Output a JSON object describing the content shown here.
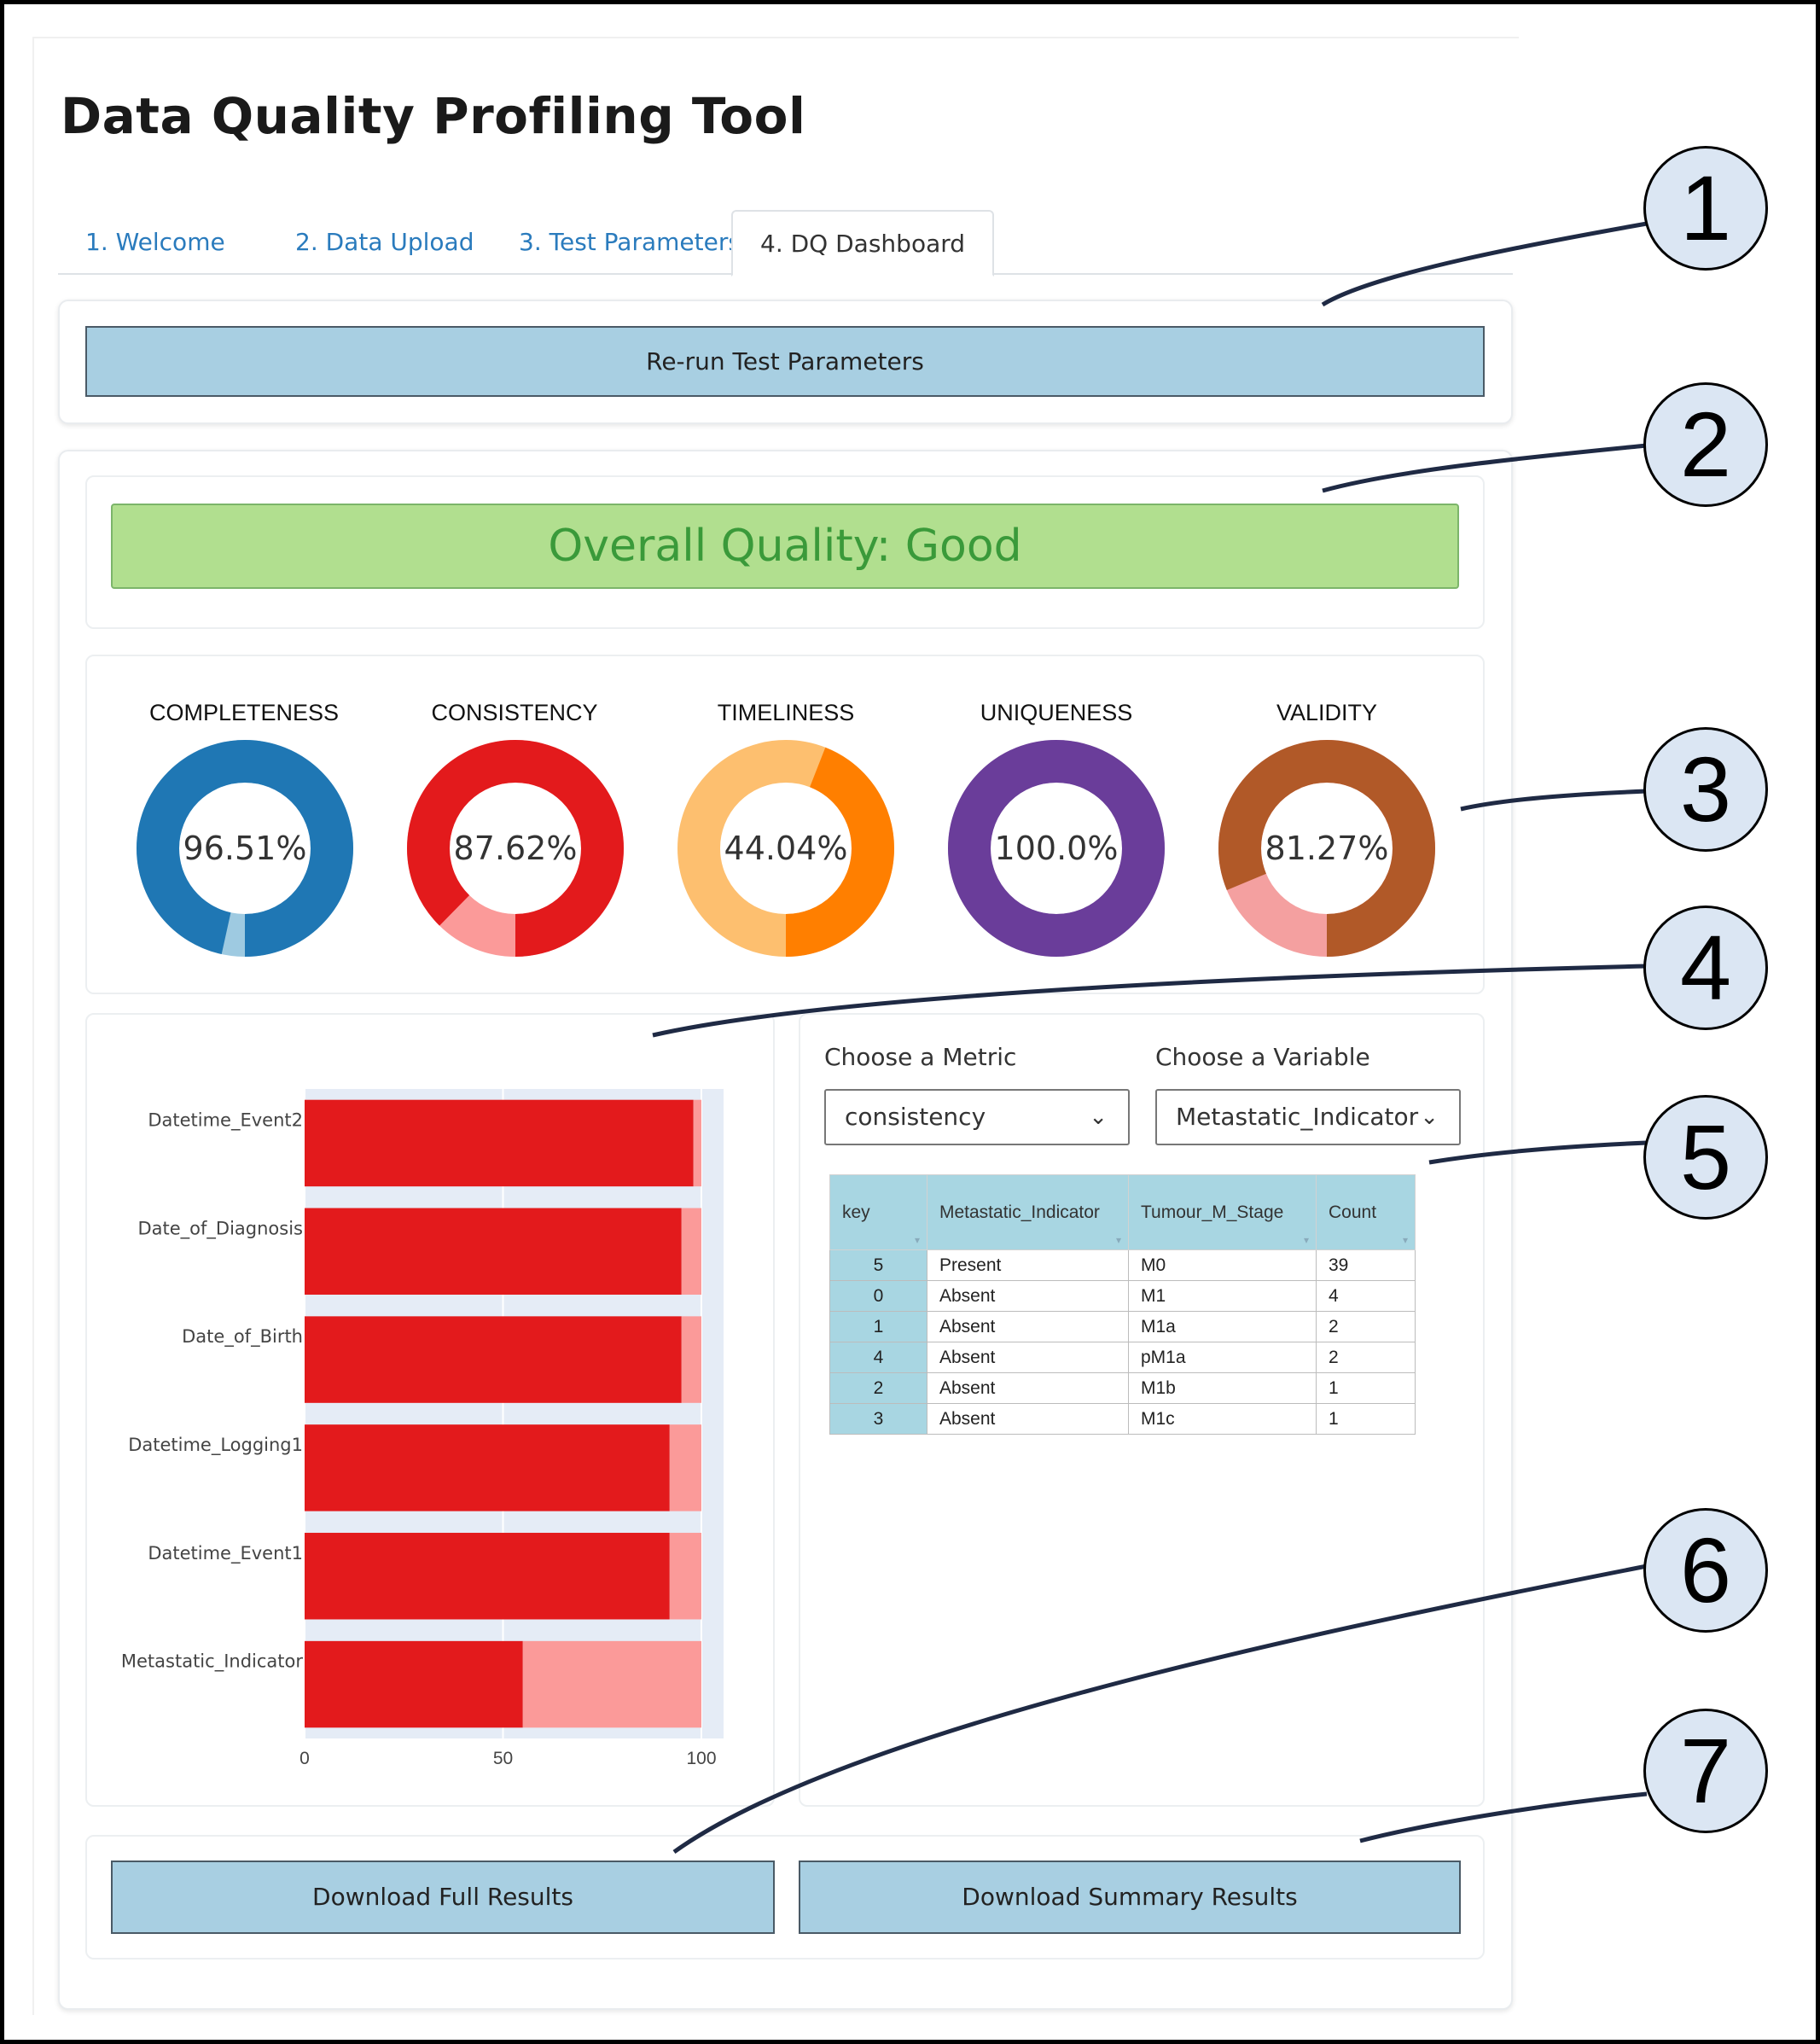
{
  "app": {
    "title": "Data Quality Profiling Tool"
  },
  "tabs": [
    "1. Welcome",
    "2. Data Upload",
    "3. Test Parameters",
    "4. DQ Dashboard"
  ],
  "actions": {
    "rerun_label": "Re-run Test Parameters"
  },
  "overall": {
    "label": "Overall Quality: Good"
  },
  "donuts": [
    {
      "label": "COMPLETENESS",
      "value_text": "96.51%",
      "value": 96.51,
      "main_color": "#1f77b4",
      "rest_color": "#9ecae1"
    },
    {
      "label": "CONSISTENCY",
      "value_text": "87.62%",
      "value": 87.62,
      "main_color": "#e31a1c",
      "rest_color": "#fb9a99"
    },
    {
      "label": "TIMELINESS",
      "value_text": "44.04%",
      "value": 44.04,
      "main_color": "#ff7f00",
      "rest_color": "#fdbf6f"
    },
    {
      "label": "UNIQUENESS",
      "value_text": "100.0%",
      "value": 100.0,
      "main_color": "#6a3d9a",
      "rest_color": "#cab2d6"
    },
    {
      "label": "VALIDITY",
      "value_text": "81.27%",
      "value": 81.27,
      "main_color": "#b15928",
      "rest_color": "#f4a0a0"
    }
  ],
  "controls": {
    "metric_label": "Choose a Metric",
    "metric_value": "consistency",
    "variable_label": "Choose a Variable",
    "variable_value": "Metastatic_Indicator"
  },
  "table": {
    "headers": [
      "key",
      "Metastatic_Indicator",
      "Tumour_M_Stage",
      "Count"
    ],
    "rows": [
      [
        "5",
        "Present",
        "M0",
        "39"
      ],
      [
        "0",
        "Absent",
        "M1",
        "4"
      ],
      [
        "1",
        "Absent",
        "M1a",
        "2"
      ],
      [
        "4",
        "Absent",
        "pM1a",
        "2"
      ],
      [
        "2",
        "Absent",
        "M1b",
        "1"
      ],
      [
        "3",
        "Absent",
        "M1c",
        "1"
      ]
    ]
  },
  "chart_data": {
    "type": "bar",
    "orientation": "horizontal",
    "stacked": true,
    "categories": [
      "Datetime_Event2",
      "Date_of_Diagnosis",
      "Date_of_Birth",
      "Datetime_Logging1",
      "Datetime_Event1",
      "Metastatic_Indicator"
    ],
    "series": [
      {
        "values": [
          98,
          95,
          95,
          92,
          92,
          55
        ],
        "color": "#e31a1c"
      },
      {
        "values": [
          2,
          5,
          5,
          8,
          8,
          45
        ],
        "color": "#fb9a99"
      }
    ],
    "xlim": [
      0,
      100
    ],
    "xticks": [
      0,
      50,
      100
    ],
    "grid": true
  },
  "downloads": {
    "full_label": "Download Full Results",
    "summary_label": "Download Summary Results"
  },
  "callouts": [
    "1",
    "2",
    "3",
    "4",
    "5",
    "6",
    "7"
  ]
}
